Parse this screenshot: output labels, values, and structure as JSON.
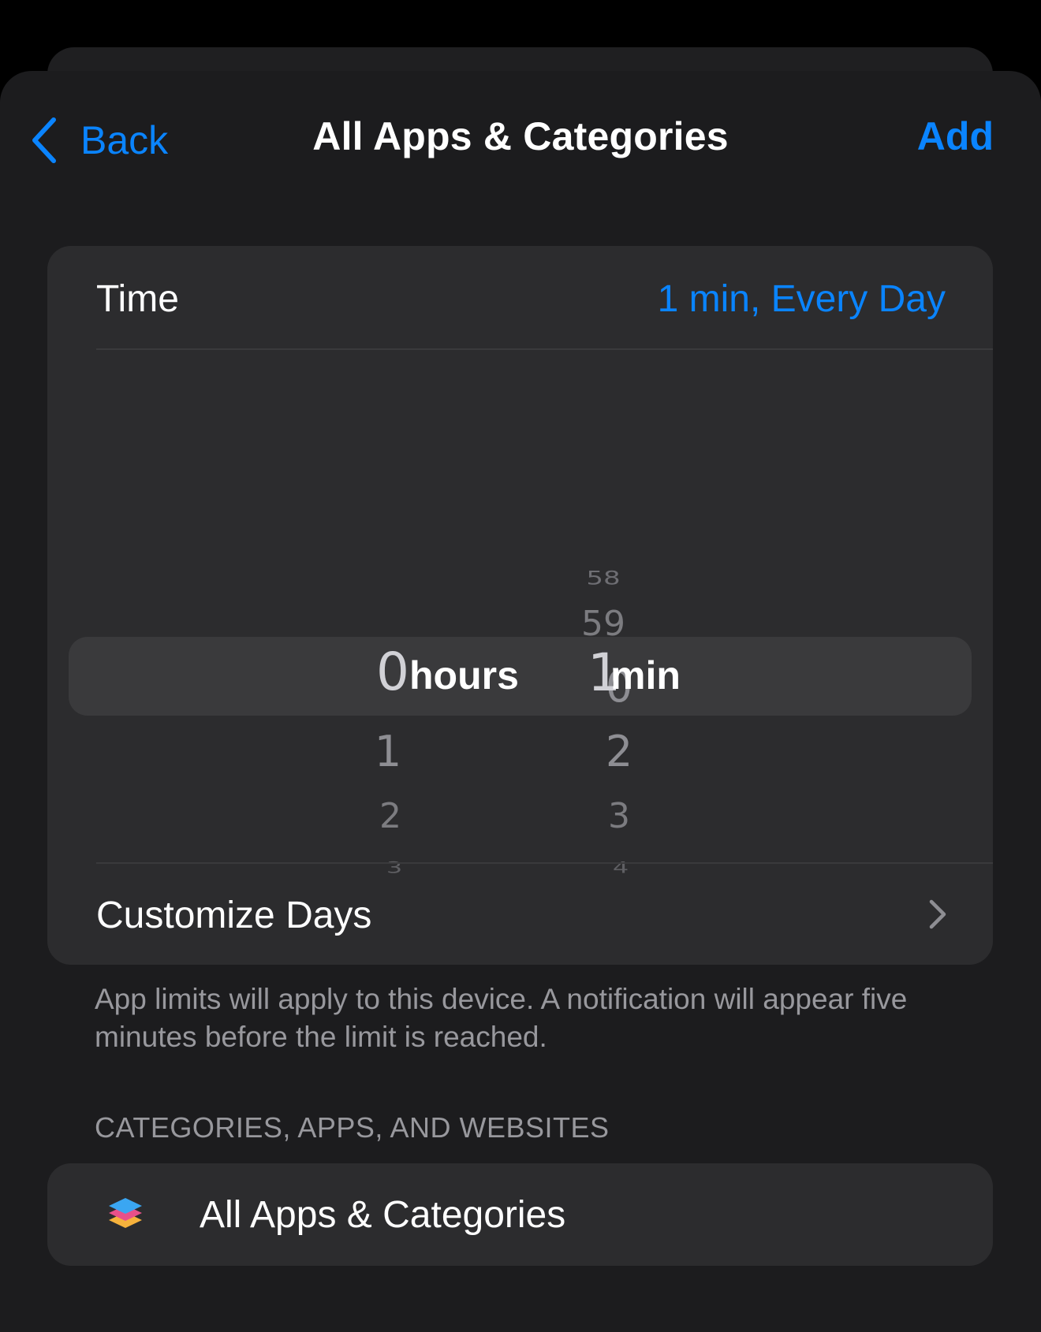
{
  "nav": {
    "back_label": "Back",
    "title": "All Apps & Categories",
    "add_label": "Add"
  },
  "time_row": {
    "label": "Time",
    "value": "1 min, Every Day"
  },
  "picker": {
    "hours": {
      "unit": "hours",
      "selected": "0",
      "below": [
        "1",
        "2",
        "3"
      ]
    },
    "minutes": {
      "unit": "min",
      "selected": "1",
      "above": [
        "58",
        "59",
        "0"
      ],
      "below": [
        "2",
        "3",
        "4"
      ]
    }
  },
  "customize_row": {
    "label": "Customize Days"
  },
  "footer_note": "App limits will apply to this device. A notification will appear five minutes before the limit is reached.",
  "section_header": "CATEGORIES, APPS, AND WEBSITES",
  "apps_row": {
    "label": "All Apps & Categories",
    "icon": "stack-layers-icon"
  },
  "colors": {
    "accent": "#0a84ff",
    "background": "#000000",
    "sheet": "#1c1c1e",
    "card": "#2c2c2e",
    "secondary_text": "#98989d"
  }
}
